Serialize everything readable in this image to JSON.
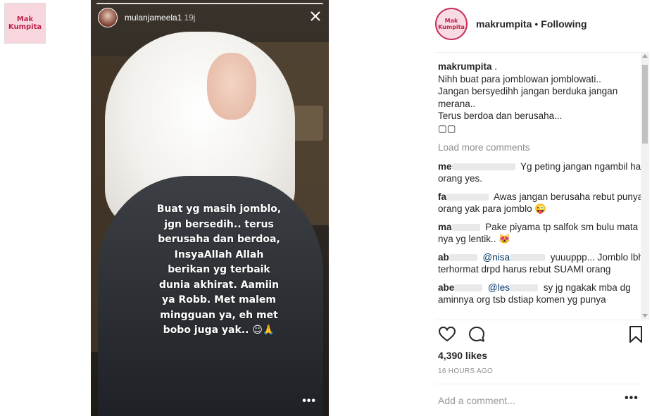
{
  "corner": {
    "logo_text": "Mak\nKumpita"
  },
  "story": {
    "username": "mulanjameela1",
    "time": "19j",
    "caption_lines": [
      "Buat yg masih jomblo,",
      "jgn bersedih.. terus",
      "berusaha dan berdoa,",
      "InsyaAllah Allah",
      "berikan yg terbaik",
      "dunia akhirat. Aamiin",
      "ya Robb. Met malem",
      "mingguan ya, eh met",
      "bobo juga yak.. ☺🙏"
    ],
    "more_label": "•••"
  },
  "post": {
    "owner": "makrumpita",
    "dot": "•",
    "following_label": "Following",
    "avatar_text": "Mak\nKumpita",
    "caption_owner": "makrumpita",
    "caption_title": ".",
    "caption_lines": [
      "Nihh buat para jomblowan jomblowati..",
      "Jangan bersyedihh jangan berduka jangan",
      "merana..",
      "Terus berdoa dan berusaha...",
      "▢▢"
    ],
    "load_more": "Load more comments",
    "comments": [
      {
        "user": "me",
        "text": "Yg peting jangan ngambil hak orang yes."
      },
      {
        "user": "fa",
        "text": "Awas jangan berusaha rebut punya orang yak para jomblo 😜"
      },
      {
        "user": "ma",
        "text": "Pake piyama tp salfok sm bulu mata nya yg lentik.. 😻"
      },
      {
        "user": "ab",
        "mention": "@nisa",
        "text": "yuuuppp... Jomblo lbh terhormat drpd harus rebut SUAMI orang"
      },
      {
        "user": "abe",
        "mention": "@les",
        "text": "sy jg ngakak mba dg aminnya org tsb dstiap komen yg punya"
      }
    ],
    "likes": "4,390 likes",
    "time": "16 HOURS AGO",
    "add_comment_placeholder": "Add a comment...",
    "more_label": "•••"
  },
  "icons": [
    "heart-icon",
    "comment-icon",
    "bookmark-icon",
    "close-icon",
    "more-icon"
  ]
}
